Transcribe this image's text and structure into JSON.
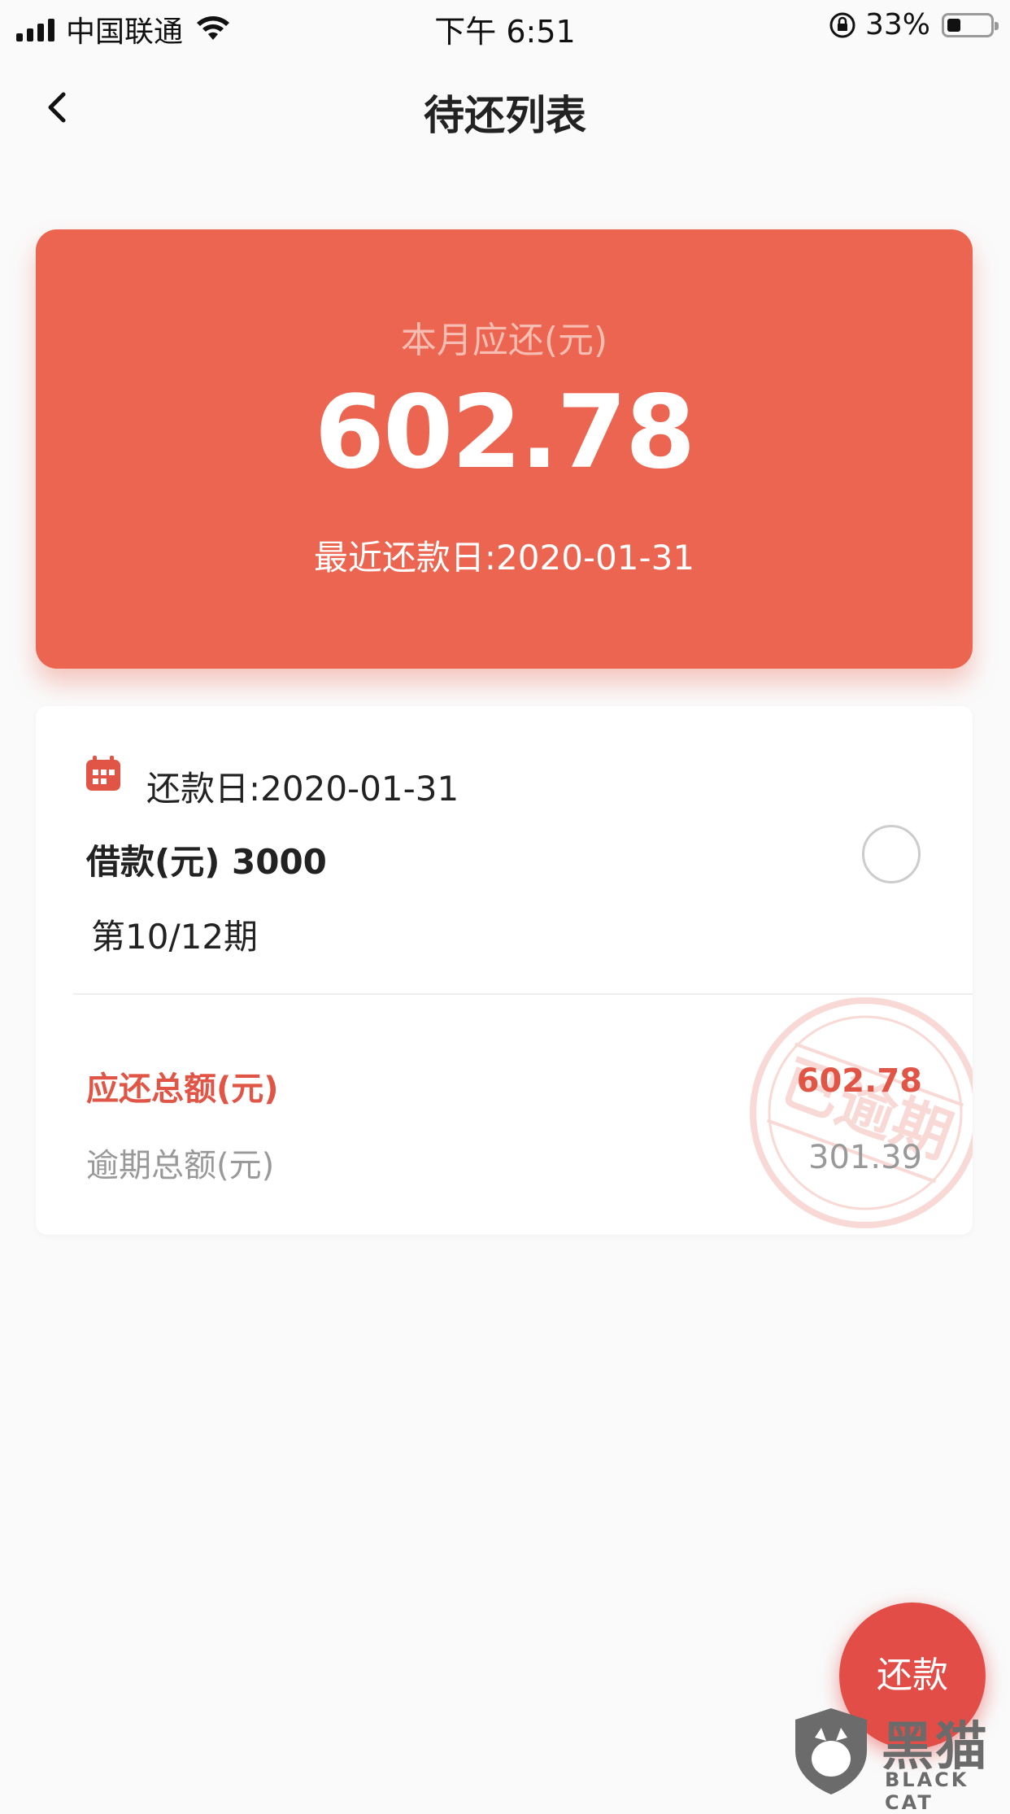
{
  "status_bar": {
    "carrier": "中国联通",
    "time": "下午 6:51",
    "battery_percent": "33%"
  },
  "header": {
    "title": "待还列表"
  },
  "summary": {
    "label": "本月应还(元)",
    "amount": "602.78",
    "recent_due": "最近还款日:2020-01-31"
  },
  "bill": {
    "due_date": "还款日:2020-01-31",
    "loan": "借款(元) 3000",
    "period": "第10/12期",
    "total_due_label": "应还总额(元)",
    "total_due_value": "602.78",
    "overdue_label": "逾期总额(元)",
    "overdue_value": "301.39",
    "stamp_text": "已逾期"
  },
  "actions": {
    "repay_label": "还款"
  },
  "watermark": {
    "cn": "黑猫",
    "en": "BLACK CAT"
  },
  "colors": {
    "accent": "#ec6550",
    "button": "#e24d48",
    "alert_text": "#e05545",
    "muted_text": "#999999"
  },
  "icons": [
    "signal-icon",
    "wifi-icon",
    "rotation-lock-icon",
    "battery-icon",
    "back-arrow-icon",
    "calendar-icon",
    "radio-circle-icon",
    "overdue-stamp-icon",
    "black-cat-shield-icon"
  ]
}
